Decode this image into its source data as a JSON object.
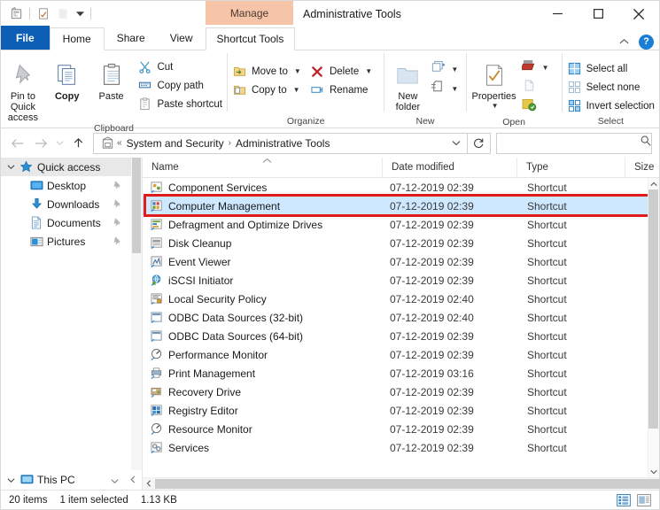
{
  "titlebar": {
    "quick_access": [
      {
        "name": "properties-qat-icon",
        "glyph": "properties"
      },
      {
        "name": "new-folder-qat-icon",
        "glyph": "newfolder"
      },
      {
        "name": "customize-qat-dropdown",
        "glyph": "chevron-down"
      }
    ],
    "contextual_tab": "Manage",
    "window_title": "Administrative Tools",
    "minimize": "—",
    "maximize": "□",
    "close": "✕"
  },
  "tabs": [
    {
      "label": "File",
      "state": "file"
    },
    {
      "label": "Home",
      "state": "active"
    },
    {
      "label": "Share",
      "state": "normal"
    },
    {
      "label": "View",
      "state": "normal"
    },
    {
      "label": "Shortcut Tools",
      "state": "contextual"
    }
  ],
  "tabstrip_right": {
    "collapse_ribbon": "⌃",
    "help": "?"
  },
  "ribbon": {
    "groups": [
      {
        "name": "Clipboard",
        "big_buttons": [
          {
            "label": "Pin to Quick\naccess",
            "label_line1": "Pin to Quick",
            "label_line2": "access",
            "icon": "pin-icon"
          },
          {
            "label": "Copy",
            "icon": "copy-icon"
          },
          {
            "label": "Paste",
            "icon": "paste-icon"
          }
        ],
        "small_buttons": [
          {
            "label": "Cut",
            "icon": "scissors-icon"
          },
          {
            "label": "Copy path",
            "icon": "copy-path-icon"
          },
          {
            "label": "Paste shortcut",
            "icon": "paste-shortcut-icon"
          }
        ]
      },
      {
        "name": "Organize",
        "small_buttons": [
          {
            "label": "Move to",
            "icon": "move-to-icon",
            "caret": true
          },
          {
            "label": "Copy to",
            "icon": "copy-to-icon",
            "caret": true
          },
          {
            "label": "Delete",
            "icon": "delete-x-icon",
            "caret": true
          },
          {
            "label": "Rename",
            "icon": "rename-icon",
            "caret": false
          }
        ]
      },
      {
        "name": "New",
        "big_buttons": [
          {
            "label_line1": "New",
            "label_line2": "folder",
            "icon": "new-folder-icon"
          }
        ],
        "small_buttons": [
          {
            "label": "",
            "icon": "new-item-icon",
            "caret": true
          },
          {
            "label": "",
            "icon": "easy-access-icon",
            "caret": true
          }
        ]
      },
      {
        "name": "Open",
        "big_buttons": [
          {
            "label_line1": "Properties",
            "label_line2": "",
            "icon": "properties-icon",
            "caret": true
          }
        ],
        "small_buttons": [
          {
            "label": "",
            "icon": "open-icon",
            "caret": true
          },
          {
            "label": "",
            "icon": "edit-icon",
            "caret": false
          },
          {
            "label": "",
            "icon": "history-icon",
            "caret": false
          }
        ]
      },
      {
        "name": "Select",
        "small_buttons": [
          {
            "label": "Select all",
            "icon": "select-all-icon"
          },
          {
            "label": "Select none",
            "icon": "select-none-icon"
          },
          {
            "label": "Invert selection",
            "icon": "invert-selection-icon"
          }
        ]
      }
    ]
  },
  "addressbar": {
    "back": "←",
    "forward": "→",
    "recent": "⌄",
    "up": "↑",
    "path_icon": "control-panel-icon",
    "path_prefix": "«",
    "crumbs": [
      "System and Security",
      "Administrative Tools"
    ],
    "crumb_separator": "›",
    "dropdown": "⌄",
    "refresh": "↻",
    "search": {
      "value": "",
      "placeholder": "",
      "icon": "search-icon"
    }
  },
  "sidebar": {
    "sections": [
      {
        "label": "Quick access",
        "icon": "star-pin-icon",
        "expanded": true,
        "items": [
          {
            "label": "Desktop",
            "icon": "desktop-icon",
            "pinned": true
          },
          {
            "label": "Downloads",
            "icon": "downloads-icon",
            "pinned": true
          },
          {
            "label": "Documents",
            "icon": "documents-icon",
            "pinned": true
          },
          {
            "label": "Pictures",
            "icon": "pictures-icon",
            "pinned": true
          }
        ]
      }
    ],
    "bottom_item": {
      "label": "This PC",
      "icon": "this-pc-icon",
      "expanded": true
    }
  },
  "columns": [
    {
      "label": "Name",
      "sorted": true,
      "sort_dir": "asc"
    },
    {
      "label": "Date modified",
      "sorted": false
    },
    {
      "label": "Type",
      "sorted": false
    },
    {
      "label": "Size",
      "sorted": false
    }
  ],
  "files": [
    {
      "name": "Component Services",
      "date": "07-12-2019 02:39",
      "type": "Shortcut",
      "size": "",
      "icon": "component-services-icon",
      "selected": false,
      "highlighted": false
    },
    {
      "name": "Computer Management",
      "date": "07-12-2019 02:39",
      "type": "Shortcut",
      "size": "",
      "icon": "computer-management-icon",
      "selected": true,
      "highlighted": true
    },
    {
      "name": "Defragment and Optimize Drives",
      "date": "07-12-2019 02:39",
      "type": "Shortcut",
      "size": "",
      "icon": "defrag-icon",
      "selected": false,
      "highlighted": false
    },
    {
      "name": "Disk Cleanup",
      "date": "07-12-2019 02:39",
      "type": "Shortcut",
      "size": "",
      "icon": "disk-cleanup-icon",
      "selected": false,
      "highlighted": false
    },
    {
      "name": "Event Viewer",
      "date": "07-12-2019 02:39",
      "type": "Shortcut",
      "size": "",
      "icon": "event-viewer-icon",
      "selected": false,
      "highlighted": false
    },
    {
      "name": "iSCSI Initiator",
      "date": "07-12-2019 02:39",
      "type": "Shortcut",
      "size": "",
      "icon": "iscsi-icon",
      "selected": false,
      "highlighted": false
    },
    {
      "name": "Local Security Policy",
      "date": "07-12-2019 02:40",
      "type": "Shortcut",
      "size": "",
      "icon": "local-security-policy-icon",
      "selected": false,
      "highlighted": false
    },
    {
      "name": "ODBC Data Sources (32-bit)",
      "date": "07-12-2019 02:40",
      "type": "Shortcut",
      "size": "",
      "icon": "odbc-icon",
      "selected": false,
      "highlighted": false
    },
    {
      "name": "ODBC Data Sources (64-bit)",
      "date": "07-12-2019 02:39",
      "type": "Shortcut",
      "size": "",
      "icon": "odbc-icon",
      "selected": false,
      "highlighted": false
    },
    {
      "name": "Performance Monitor",
      "date": "07-12-2019 02:39",
      "type": "Shortcut",
      "size": "",
      "icon": "performance-monitor-icon",
      "selected": false,
      "highlighted": false
    },
    {
      "name": "Print Management",
      "date": "07-12-2019 03:16",
      "type": "Shortcut",
      "size": "",
      "icon": "print-management-icon",
      "selected": false,
      "highlighted": false
    },
    {
      "name": "Recovery Drive",
      "date": "07-12-2019 02:39",
      "type": "Shortcut",
      "size": "",
      "icon": "recovery-drive-icon",
      "selected": false,
      "highlighted": false
    },
    {
      "name": "Registry Editor",
      "date": "07-12-2019 02:39",
      "type": "Shortcut",
      "size": "",
      "icon": "registry-editor-icon",
      "selected": false,
      "highlighted": false
    },
    {
      "name": "Resource Monitor",
      "date": "07-12-2019 02:39",
      "type": "Shortcut",
      "size": "",
      "icon": "resource-monitor-icon",
      "selected": false,
      "highlighted": false
    },
    {
      "name": "Services",
      "date": "07-12-2019 02:39",
      "type": "Shortcut",
      "size": "",
      "icon": "services-icon",
      "selected": false,
      "highlighted": false
    }
  ],
  "statusbar": {
    "item_count": "20 items",
    "selection": "1 item selected",
    "size": "1.13 KB",
    "view_details": "details-view-icon",
    "view_large": "large-icons-view-icon"
  },
  "colors": {
    "file_tab_blue": "#0d5eb5",
    "contextual_tab": "#f6c5a8",
    "selection_blue": "#cde8ff",
    "highlight_red": "#e01b1b",
    "help_blue": "#1a7fd4"
  }
}
